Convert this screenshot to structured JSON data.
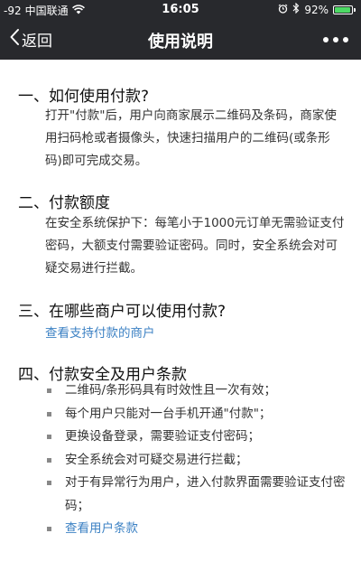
{
  "status": {
    "signal": "-92",
    "carrier": "中国联通",
    "time": "16:05",
    "battery": "92%",
    "battery_level": 0.92,
    "battery_color": "#4cd964"
  },
  "nav": {
    "back_label": "返回",
    "title": "使用说明",
    "bg_color": "#28292d"
  },
  "sections": {
    "s1": {
      "title": "一、如何使用付款?",
      "body": "打开\"付款\"后，用户向商家展示二维码及条码，商家使用扫码枪或者摄像头，快速扫描用户的二维码(或条形码)即可完成交易。"
    },
    "s2": {
      "title": "二、付款额度",
      "body": "在安全系统保护下：每笔小于1000元订单无需验证支付密码，大额支付需要验证密码。同时，安全系统会对可疑交易进行拦截。"
    },
    "s3": {
      "title": "三、在哪些商户可以使用付款?",
      "link": "查看支持付款的商户"
    },
    "s4": {
      "title": "四、付款安全及用户条款",
      "items": [
        "二维码/条形码具有时效性且一次有效；",
        "每个用户只能对一台手机开通\"付款\"；",
        "更换设备登录，需要验证支付密码；",
        "安全系统会对可疑交易进行拦截；",
        "对于有异常行为用户，进入付款界面需要验证支付密码；"
      ],
      "link": "查看用户条款"
    }
  },
  "colors": {
    "link": "#3d82c4",
    "text": "#333333"
  }
}
